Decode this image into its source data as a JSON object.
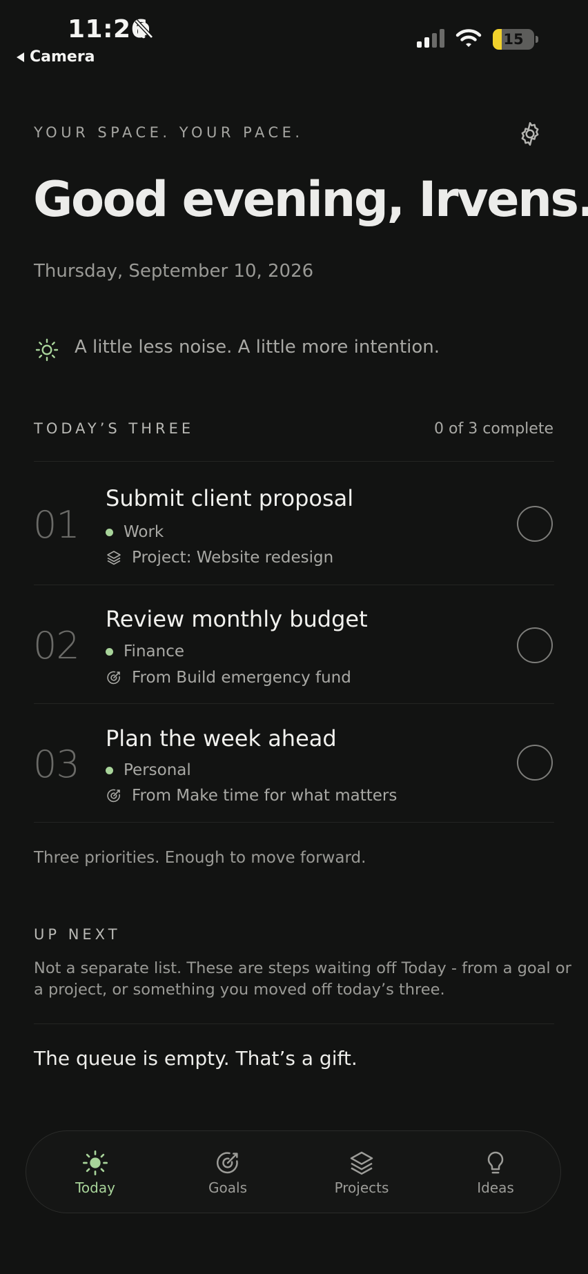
{
  "status_bar": {
    "time": "11:26",
    "back_label": "Camera",
    "battery": "15"
  },
  "header": {
    "tagline": "YOUR SPACE. YOUR PACE.",
    "greeting": "Good evening, Irvens.",
    "date": "Thursday, September 10, 2026",
    "intention": "A little less noise. A little more intention."
  },
  "todays_three": {
    "title": "TODAY’S THREE",
    "progress": "0 of 3 complete",
    "tasks": [
      {
        "number": "01",
        "title": "Submit client proposal",
        "category": "Work",
        "source": "Project: Website redesign",
        "source_icon": "layers-icon"
      },
      {
        "number": "02",
        "title": "Review monthly budget",
        "category": "Finance",
        "source": "From Build emergency fund",
        "source_icon": "target-icon"
      },
      {
        "number": "03",
        "title": "Plan the week ahead",
        "category": "Personal",
        "source": "From Make time for what matters",
        "source_icon": "target-icon"
      }
    ],
    "footer": "Three priorities. Enough to move forward."
  },
  "up_next": {
    "title": "UP NEXT",
    "description": "Not a separate list. These are steps waiting off Today - from a goal or a project, or something you moved off today’s three.",
    "empty_message": "The queue is empty. That’s a gift."
  },
  "nav": {
    "items": [
      {
        "label": "Today",
        "icon": "sun-icon",
        "active": true
      },
      {
        "label": "Goals",
        "icon": "target-icon",
        "active": false
      },
      {
        "label": "Projects",
        "icon": "layers-icon",
        "active": false
      },
      {
        "label": "Ideas",
        "icon": "lightbulb-icon",
        "active": false
      }
    ]
  },
  "colors": {
    "background": "#121312",
    "accent": "#a8d49a",
    "text": "#ececea",
    "muted": "#9a9a96"
  }
}
